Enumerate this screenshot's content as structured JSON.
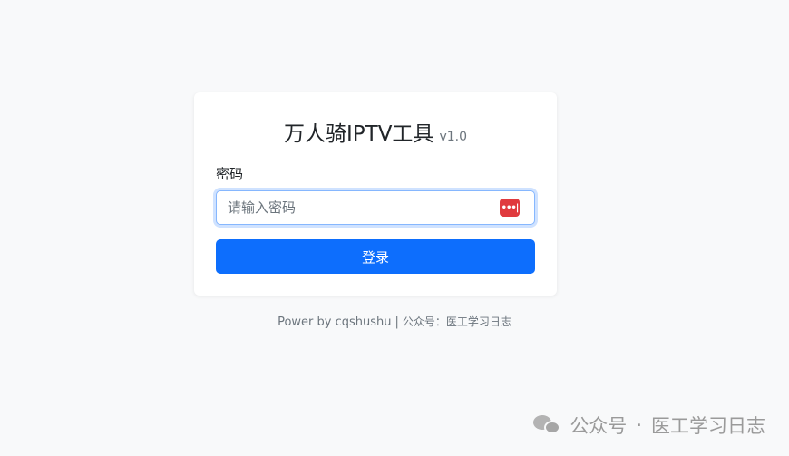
{
  "header": {
    "title": "万人骑IPTV工具",
    "version": "v1.0"
  },
  "form": {
    "password_label": "密码",
    "password_placeholder": "请输入密码",
    "password_manager_icon": "password-manager-icon",
    "password_icon_glyph": "•••|",
    "login_label": "登录"
  },
  "footer": {
    "power_text": "Power by cqshushu",
    "separator": "|",
    "account_prefix": "公众号：",
    "account_name": "医工学习日志"
  },
  "watermark": {
    "logo_icon": "wechat-icon",
    "prefix": "公众号",
    "dot": "·",
    "name": "医工学习日志"
  },
  "colors": {
    "background": "#f8f9fa",
    "primary": "#0d6efd",
    "focus_border": "#86b7fe",
    "muted_text": "#6c757d",
    "icon_red": "#e03a3e"
  }
}
